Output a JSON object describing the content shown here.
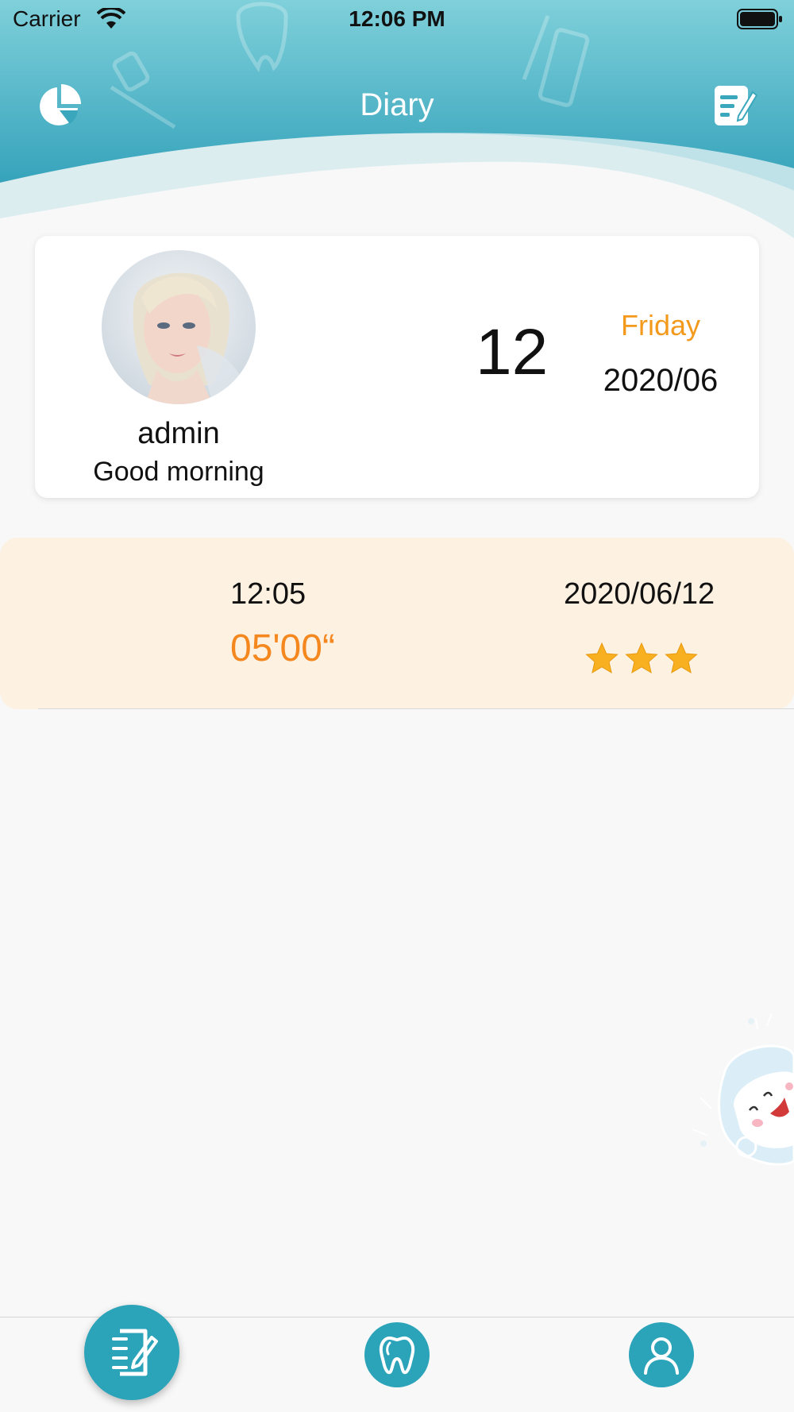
{
  "status_bar": {
    "carrier": "Carrier",
    "time": "12:06 PM"
  },
  "header": {
    "title": "Diary",
    "left_icon": "pie-chart-icon",
    "right_icon": "edit-note-icon",
    "colors": {
      "top": "#7ccfd9",
      "bottom": "#3aa7bd"
    }
  },
  "profile": {
    "username": "admin",
    "greeting": "Good morning",
    "day": "12",
    "weekday": "Friday",
    "year_month": "2020/06"
  },
  "records": [
    {
      "time": "12:05",
      "duration": "05'00“",
      "date": "2020/06/12",
      "rating": 3,
      "max_rating": 3
    }
  ],
  "tabbar": {
    "items": [
      {
        "icon": "diary-edit-icon",
        "active": true
      },
      {
        "icon": "tooth-icon",
        "active": false
      },
      {
        "icon": "user-icon",
        "active": false
      }
    ],
    "accent": "#2ba3b9"
  },
  "colors": {
    "accent_orange": "#f39a1c",
    "duration_orange": "#f5871f",
    "record_bg": "#fdf1e2",
    "star": "#f8b020"
  }
}
